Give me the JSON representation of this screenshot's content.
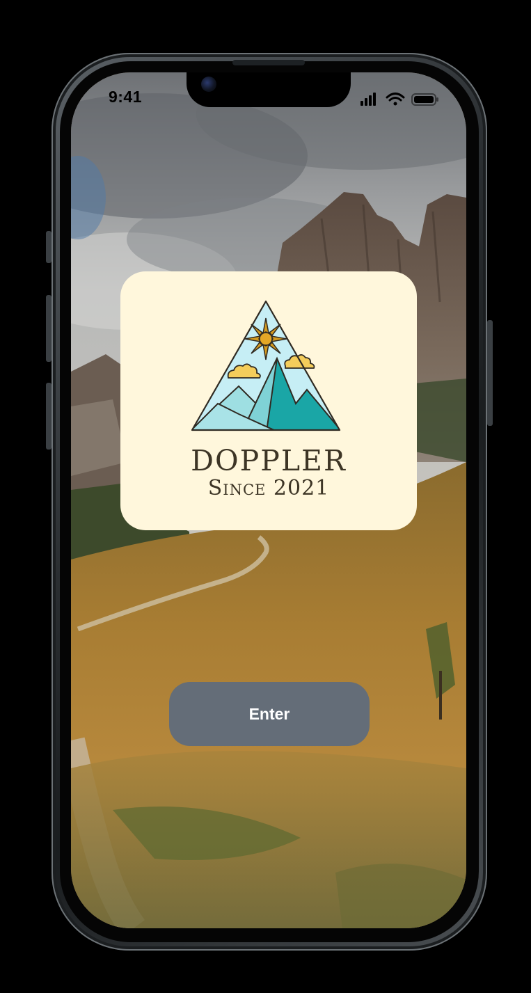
{
  "status_bar": {
    "time": "9:41",
    "icons": [
      "cellular-signal-icon",
      "wifi-icon",
      "battery-icon"
    ]
  },
  "logo": {
    "icon": "mountain-sun-logo-icon",
    "name": "DOPPLER",
    "tagline": "Since 2021"
  },
  "enter_button": {
    "label": "Enter"
  },
  "colors": {
    "card_background": "#fff7dc",
    "button_background": "#646d78",
    "button_text": "#ffffff",
    "sky": "#c6eef5",
    "mountain_dark": "#1aa6a6",
    "mountain_light": "#9edfe2",
    "sun": "#d49a1f",
    "cloud": "#f4cd5b"
  }
}
